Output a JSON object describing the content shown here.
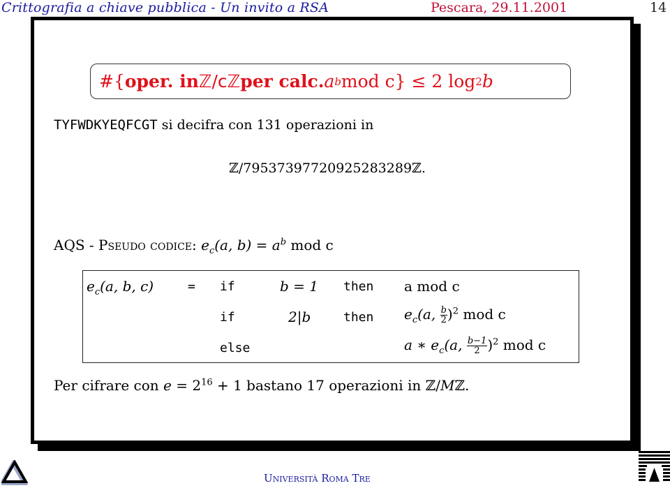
{
  "header": {
    "title": "Crittografia a chiave pubblica - Un invito a RSA",
    "date": "Pescara, 29.11.2001",
    "page_number": "14"
  },
  "highlight_box": {
    "prefix": "#{",
    "bold_text": "oper. in ",
    "ring": "ℤ/cℤ",
    "bold_text2": " per calc. ",
    "expr_base": "a",
    "expr_exp": "b",
    "expr_rest": " mod c} ≤ 2 log",
    "log_sub": "2",
    "log_arg": " b",
    "color": "#e0101a"
  },
  "line1": {
    "ciphertext": "TYFWDKYEQFCGT",
    "text": " si decifra con 131 operazioni in"
  },
  "line2": {
    "ring": "ℤ/795373977209252832​89ℤ."
  },
  "aqs": {
    "prefix": "AQS - ",
    "pseudo": "Pseudo codice:",
    "formula_lhs": "e",
    "formula_sub": "c",
    "formula_args": "(a, b) = a",
    "formula_exp": "b",
    "formula_rest": " mod c"
  },
  "code": {
    "lhs": "e",
    "lhs_sub": "c",
    "lhs_args": "(a, b, c)",
    "eq": "=",
    "rows": [
      {
        "kw": "if",
        "cond": "b = 1",
        "then": "then",
        "result": "a mod c"
      },
      {
        "kw": "if",
        "cond": "2|b",
        "then": "then",
        "result_pre": "e",
        "result_sub": "c",
        "result_args": "(a, ",
        "frac_num": "b",
        "frac_den": "2",
        "result_post": ")",
        "result_exp": "2",
        "result_tail": " mod c"
      },
      {
        "kw": "else",
        "cond": "",
        "then": "",
        "result_pre": "a ∗ e",
        "result_sub": "c",
        "result_args": "(a, ",
        "frac_num": "b−1",
        "frac_den": "2",
        "result_post": ")",
        "result_exp": "2",
        "result_tail": " mod c"
      }
    ]
  },
  "final_line": {
    "pre": "Per cifrare con ",
    "e": "e",
    "eq": " = 2",
    "exp": "16",
    "post": " + 1 bastano 17 operazioni in ℤ/",
    "M": "M",
    "tail": "ℤ."
  },
  "footer": {
    "university": "Università Roma Tre"
  },
  "icons": {
    "left_logo": "triangle-logo-icon",
    "right_logo": "roma-tre-logo-icon"
  }
}
